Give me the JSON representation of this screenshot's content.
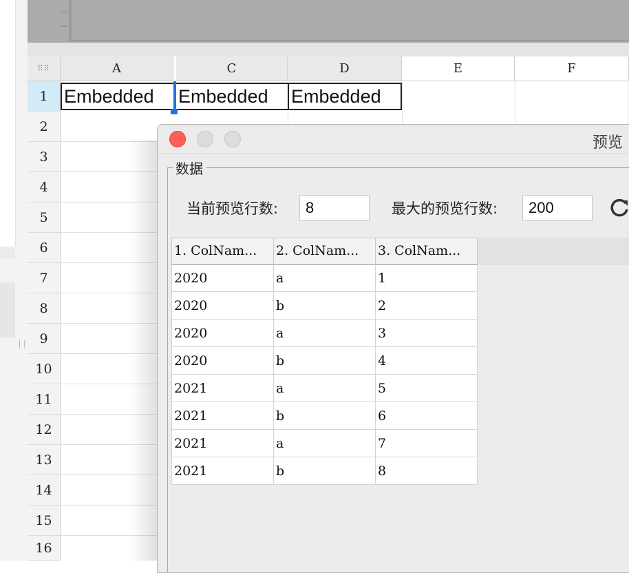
{
  "spreadsheet": {
    "select_all_icon": "grid-dots-icon",
    "columns": [
      "A",
      "C",
      "D",
      "E",
      "F"
    ],
    "rows": [
      "1",
      "2",
      "3",
      "4",
      "5",
      "6",
      "7",
      "8",
      "9",
      "10",
      "11",
      "12",
      "13",
      "14",
      "15",
      "16"
    ],
    "cells_row1": [
      "Embedded",
      "Embedded",
      "Embedded"
    ],
    "selection_color": "#1f74e0",
    "active_row_color": "#d3ebf6"
  },
  "dialog": {
    "title": "预览",
    "controls": [
      "close-icon",
      "minimize-icon",
      "maximize-icon"
    ],
    "close_color": "#ff5f57",
    "group_label": "数据",
    "current_rows_label": "当前预览行数:",
    "current_rows_value": "8",
    "max_rows_label": "最大的预览行数:",
    "max_rows_value": "200",
    "refresh_icon": "refresh-icon",
    "table": {
      "headers": [
        "1. ColNam...",
        "2. ColNam...",
        "3. ColNam..."
      ],
      "rows": [
        [
          "2020",
          "a",
          "1"
        ],
        [
          "2020",
          "b",
          "2"
        ],
        [
          "2020",
          "a",
          "3"
        ],
        [
          "2020",
          "b",
          "4"
        ],
        [
          "2021",
          "a",
          "5"
        ],
        [
          "2021",
          "b",
          "6"
        ],
        [
          "2021",
          "a",
          "7"
        ],
        [
          "2021",
          "b",
          "8"
        ]
      ]
    }
  }
}
